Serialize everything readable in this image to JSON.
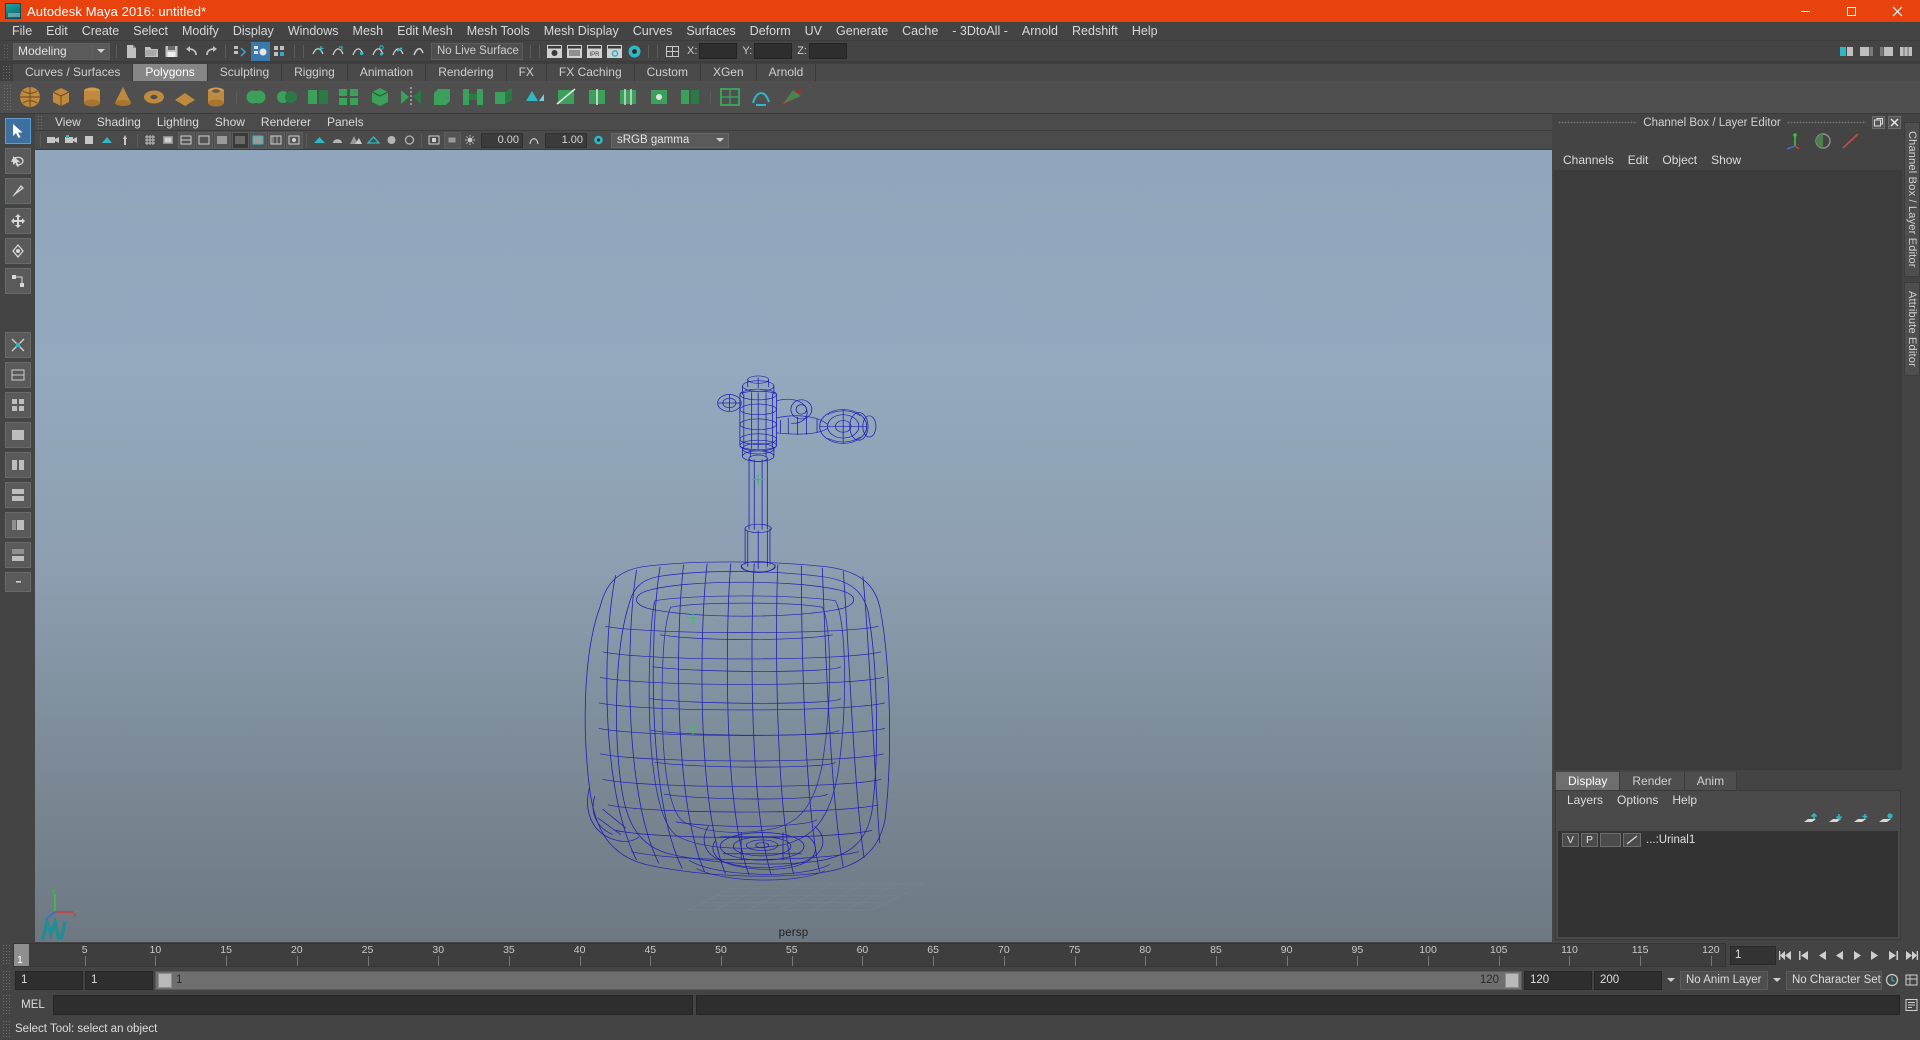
{
  "window": {
    "title": "Autodesk Maya 2016: untitled*",
    "app_icon": "maya-logo-icon",
    "buttons": {
      "minimize": "minimize-button",
      "maximize": "maximize-button",
      "close": "close-button"
    }
  },
  "menubar": {
    "items": [
      "File",
      "Edit",
      "Create",
      "Select",
      "Modify",
      "Display",
      "Windows",
      "Mesh",
      "Edit Mesh",
      "Mesh Tools",
      "Mesh Display",
      "Curves",
      "Surfaces",
      "Deform",
      "UV",
      "Generate",
      "Cache",
      "- 3DtoAll -",
      "Arnold",
      "Redshift",
      "Help"
    ]
  },
  "statusline": {
    "menu_set": "Modeling",
    "live_surface": "No Live Surface",
    "coord_labels": {
      "x": "X:",
      "y": "Y:",
      "z": "Z:"
    },
    "coord_values": {
      "x": "",
      "y": "",
      "z": ""
    }
  },
  "shelf": {
    "tabs": [
      "Curves / Surfaces",
      "Polygons",
      "Sculpting",
      "Rigging",
      "Animation",
      "Rendering",
      "FX",
      "FX Caching",
      "Custom",
      "XGen",
      "Arnold"
    ],
    "active_tab": "Polygons"
  },
  "viewport": {
    "menus": [
      "View",
      "Shading",
      "Lighting",
      "Show",
      "Renderer",
      "Panels"
    ],
    "exposure": "0.00",
    "gamma": "1.00",
    "color_profile": "sRGB gamma",
    "camera_label": "persp"
  },
  "right_panel": {
    "title": "Channel Box / Layer Editor",
    "menus": [
      "Channels",
      "Edit",
      "Object",
      "Show"
    ],
    "layer_tabs": [
      "Display",
      "Render",
      "Anim"
    ],
    "active_layer_tab": "Display",
    "layer_menus": [
      "Layers",
      "Options",
      "Help"
    ],
    "layers": [
      {
        "visibility": "V",
        "playback": "P",
        "type": "",
        "name": "...:Urinal1"
      }
    ],
    "vertical_tabs": [
      "Channel Box / Layer Editor",
      "Attribute Editor"
    ]
  },
  "timeline": {
    "ticks": [
      5,
      10,
      15,
      20,
      25,
      30,
      35,
      40,
      45,
      50,
      55,
      60,
      65,
      70,
      75,
      80,
      85,
      90,
      95,
      100,
      105,
      110,
      115,
      120
    ],
    "current_frame": "1",
    "current_frame_field": "1",
    "range_start": "1",
    "range_end": "1",
    "playback_start": "1",
    "playback_end": "120",
    "anim_start": "120",
    "anim_end": "200",
    "anim_layer": "No Anim Layer",
    "character_set": "No Character Set"
  },
  "command_line": {
    "language": "MEL",
    "command": "",
    "result": ""
  },
  "help_line": {
    "text": "Select Tool: select an object"
  },
  "colors": {
    "title_bar": "#e8430f",
    "chrome": "#444444",
    "accent_blue": "#3b79ad",
    "shelf_icon_green": "#3aa05a",
    "wireframe": "#1a1ab4"
  }
}
